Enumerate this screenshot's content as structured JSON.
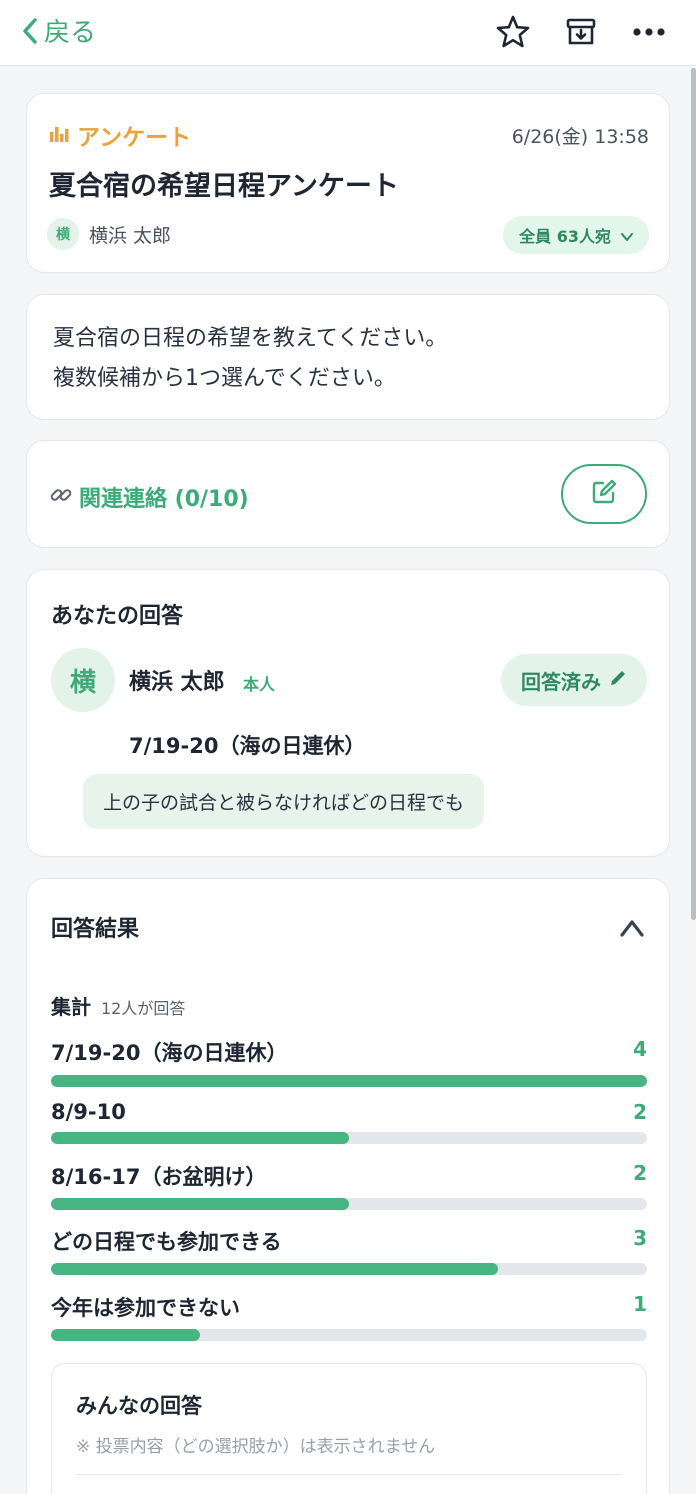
{
  "nav": {
    "back_label": "戻る",
    "icons": [
      "chevron-left-icon",
      "star-icon",
      "archive-icon",
      "more-icon"
    ]
  },
  "header": {
    "type_label": "アンケート",
    "datetime": "6/26(金) 13:58",
    "title": "夏合宿の希望日程アンケート",
    "sender_initial": "横",
    "sender_name": "横浜 太郎",
    "recipients": "全員 63人宛"
  },
  "body": {
    "line1": "夏合宿の日程の希望を教えてください。",
    "line2": "複数候補から1つ選んでください。"
  },
  "related": {
    "label": "関連連絡 (0/10)"
  },
  "your_answer": {
    "title": "あなたの回答",
    "initial": "横",
    "name": "横浜 太郎",
    "self_tag": "本人",
    "status": "回答済み",
    "choice": "7/19-20（海の日連休）",
    "comment": "上の子の試合と被らなければどの日程でも"
  },
  "results": {
    "title": "回答結果",
    "summary_title": "集計",
    "summary_count": "12人が回答",
    "options": [
      {
        "label": "7/19-20（海の日連休）",
        "count": "4"
      },
      {
        "label": "8/9-10",
        "count": "2"
      },
      {
        "label": "8/16-17（お盆明け）",
        "count": "2"
      },
      {
        "label": "どの日程でも参加できる",
        "count": "3"
      },
      {
        "label": "今年は参加できない",
        "count": "1"
      }
    ],
    "everyone_title": "みんなの回答",
    "everyone_note": "※ 投票内容（どの選択肢か）は表示されません"
  },
  "colors": {
    "accent": "#3dab78",
    "type_orange": "#e8a33a",
    "bar_track": "#e3e7ec"
  }
}
